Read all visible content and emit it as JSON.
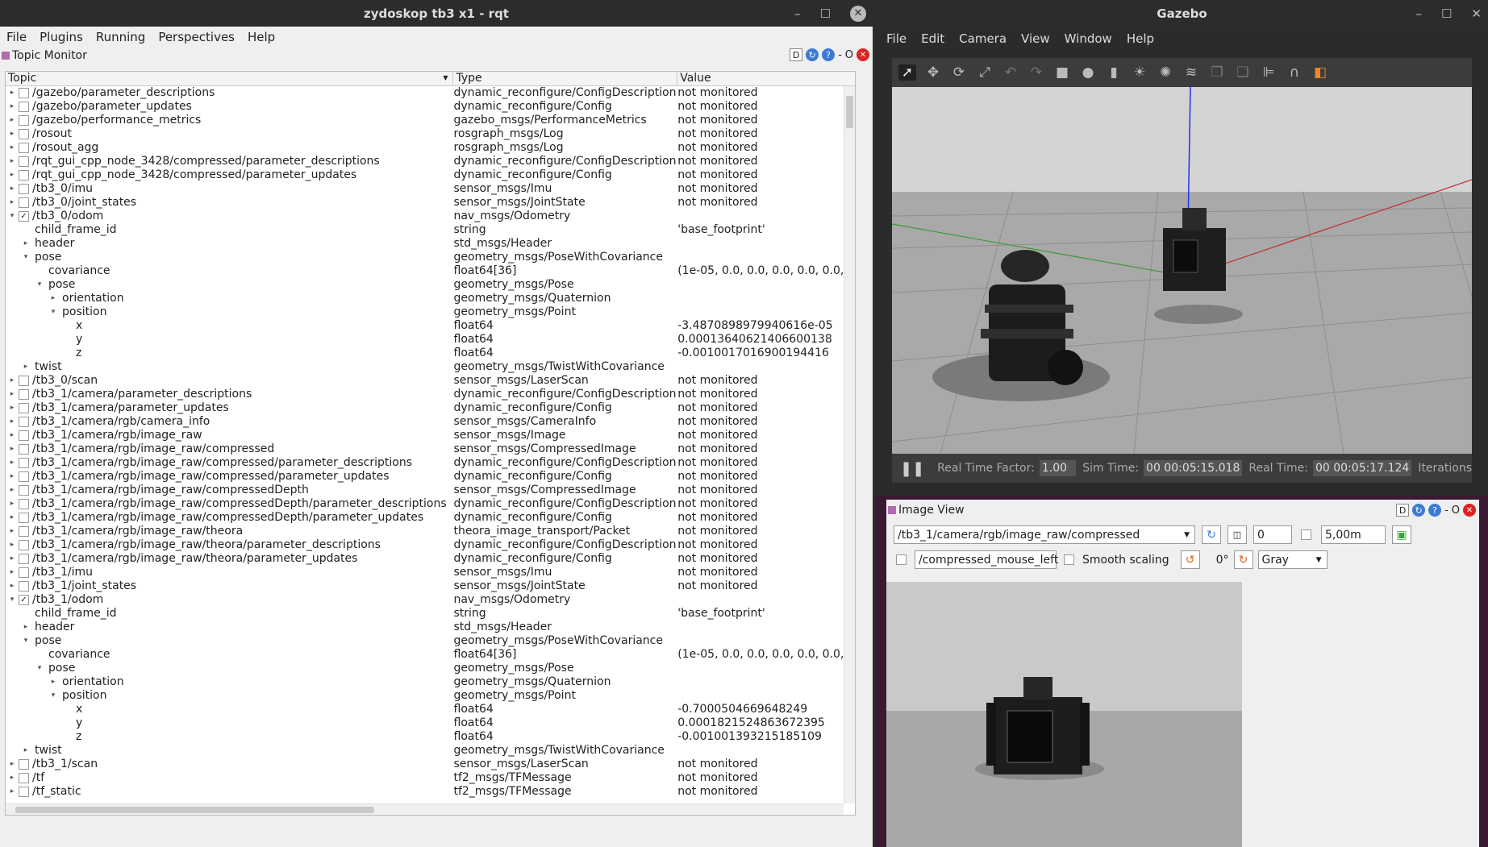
{
  "rqt": {
    "title": "zydoskop tb3 x1 - rqt",
    "menu": [
      "File",
      "Plugins",
      "Running",
      "Perspectives",
      "Help"
    ],
    "plugin": "Topic Monitor",
    "columns": [
      "Topic",
      "Type",
      "Value"
    ],
    "rows": [
      {
        "t": "/gazebo/parameter_descriptions",
        "ty": "dynamic_reconfigure/ConfigDescription",
        "v": "not monitored",
        "l": 0,
        "a": "r",
        "c": 0
      },
      {
        "t": "/gazebo/parameter_updates",
        "ty": "dynamic_reconfigure/Config",
        "v": "not monitored",
        "l": 0,
        "a": "r",
        "c": 0
      },
      {
        "t": "/gazebo/performance_metrics",
        "ty": "gazebo_msgs/PerformanceMetrics",
        "v": "not monitored",
        "l": 0,
        "a": "r",
        "c": 0
      },
      {
        "t": "/rosout",
        "ty": "rosgraph_msgs/Log",
        "v": "not monitored",
        "l": 0,
        "a": "r",
        "c": 0
      },
      {
        "t": "/rosout_agg",
        "ty": "rosgraph_msgs/Log",
        "v": "not monitored",
        "l": 0,
        "a": "r",
        "c": 0
      },
      {
        "t": "/rqt_gui_cpp_node_3428/compressed/parameter_descriptions",
        "ty": "dynamic_reconfigure/ConfigDescription",
        "v": "not monitored",
        "l": 0,
        "a": "r",
        "c": 0
      },
      {
        "t": "/rqt_gui_cpp_node_3428/compressed/parameter_updates",
        "ty": "dynamic_reconfigure/Config",
        "v": "not monitored",
        "l": 0,
        "a": "r",
        "c": 0
      },
      {
        "t": "/tb3_0/imu",
        "ty": "sensor_msgs/Imu",
        "v": "not monitored",
        "l": 0,
        "a": "r",
        "c": 0
      },
      {
        "t": "/tb3_0/joint_states",
        "ty": "sensor_msgs/JointState",
        "v": "not monitored",
        "l": 0,
        "a": "r",
        "c": 0
      },
      {
        "t": "/tb3_0/odom",
        "ty": "nav_msgs/Odometry",
        "v": "",
        "l": 0,
        "a": "d",
        "c": 1
      },
      {
        "t": "child_frame_id",
        "ty": "string",
        "v": "'base_footprint'",
        "l": 1,
        "a": "",
        "c": -1
      },
      {
        "t": "header",
        "ty": "std_msgs/Header",
        "v": "",
        "l": 1,
        "a": "r",
        "c": -1
      },
      {
        "t": "pose",
        "ty": "geometry_msgs/PoseWithCovariance",
        "v": "",
        "l": 1,
        "a": "d",
        "c": -1
      },
      {
        "t": "covariance",
        "ty": "float64[36]",
        "v": "(1e-05, 0.0, 0.0, 0.0, 0.0, 0.0,",
        "l": 2,
        "a": "",
        "c": -1
      },
      {
        "t": "pose",
        "ty": "geometry_msgs/Pose",
        "v": "",
        "l": 2,
        "a": "d",
        "c": -1
      },
      {
        "t": "orientation",
        "ty": "geometry_msgs/Quaternion",
        "v": "",
        "l": 3,
        "a": "r",
        "c": -1
      },
      {
        "t": "position",
        "ty": "geometry_msgs/Point",
        "v": "",
        "l": 3,
        "a": "d",
        "c": -1
      },
      {
        "t": "x",
        "ty": "float64",
        "v": "-3.4870898979940616e-05",
        "l": 4,
        "a": "",
        "c": -1
      },
      {
        "t": "y",
        "ty": "float64",
        "v": "0.00013640621406600138",
        "l": 4,
        "a": "",
        "c": -1
      },
      {
        "t": "z",
        "ty": "float64",
        "v": "-0.0010017016900194416",
        "l": 4,
        "a": "",
        "c": -1
      },
      {
        "t": "twist",
        "ty": "geometry_msgs/TwistWithCovariance",
        "v": "",
        "l": 1,
        "a": "r",
        "c": -1
      },
      {
        "t": "/tb3_0/scan",
        "ty": "sensor_msgs/LaserScan",
        "v": "not monitored",
        "l": 0,
        "a": "r",
        "c": 0
      },
      {
        "t": "/tb3_1/camera/parameter_descriptions",
        "ty": "dynamic_reconfigure/ConfigDescription",
        "v": "not monitored",
        "l": 0,
        "a": "r",
        "c": 0
      },
      {
        "t": "/tb3_1/camera/parameter_updates",
        "ty": "dynamic_reconfigure/Config",
        "v": "not monitored",
        "l": 0,
        "a": "r",
        "c": 0
      },
      {
        "t": "/tb3_1/camera/rgb/camera_info",
        "ty": "sensor_msgs/CameraInfo",
        "v": "not monitored",
        "l": 0,
        "a": "r",
        "c": 0
      },
      {
        "t": "/tb3_1/camera/rgb/image_raw",
        "ty": "sensor_msgs/Image",
        "v": "not monitored",
        "l": 0,
        "a": "r",
        "c": 0
      },
      {
        "t": "/tb3_1/camera/rgb/image_raw/compressed",
        "ty": "sensor_msgs/CompressedImage",
        "v": "not monitored",
        "l": 0,
        "a": "r",
        "c": 0
      },
      {
        "t": "/tb3_1/camera/rgb/image_raw/compressed/parameter_descriptions",
        "ty": "dynamic_reconfigure/ConfigDescription",
        "v": "not monitored",
        "l": 0,
        "a": "r",
        "c": 0
      },
      {
        "t": "/tb3_1/camera/rgb/image_raw/compressed/parameter_updates",
        "ty": "dynamic_reconfigure/Config",
        "v": "not monitored",
        "l": 0,
        "a": "r",
        "c": 0
      },
      {
        "t": "/tb3_1/camera/rgb/image_raw/compressedDepth",
        "ty": "sensor_msgs/CompressedImage",
        "v": "not monitored",
        "l": 0,
        "a": "r",
        "c": 0
      },
      {
        "t": "/tb3_1/camera/rgb/image_raw/compressedDepth/parameter_descriptions",
        "ty": "dynamic_reconfigure/ConfigDescription",
        "v": "not monitored",
        "l": 0,
        "a": "r",
        "c": 0
      },
      {
        "t": "/tb3_1/camera/rgb/image_raw/compressedDepth/parameter_updates",
        "ty": "dynamic_reconfigure/Config",
        "v": "not monitored",
        "l": 0,
        "a": "r",
        "c": 0
      },
      {
        "t": "/tb3_1/camera/rgb/image_raw/theora",
        "ty": "theora_image_transport/Packet",
        "v": "not monitored",
        "l": 0,
        "a": "r",
        "c": 0
      },
      {
        "t": "/tb3_1/camera/rgb/image_raw/theora/parameter_descriptions",
        "ty": "dynamic_reconfigure/ConfigDescription",
        "v": "not monitored",
        "l": 0,
        "a": "r",
        "c": 0
      },
      {
        "t": "/tb3_1/camera/rgb/image_raw/theora/parameter_updates",
        "ty": "dynamic_reconfigure/Config",
        "v": "not monitored",
        "l": 0,
        "a": "r",
        "c": 0
      },
      {
        "t": "/tb3_1/imu",
        "ty": "sensor_msgs/Imu",
        "v": "not monitored",
        "l": 0,
        "a": "r",
        "c": 0
      },
      {
        "t": "/tb3_1/joint_states",
        "ty": "sensor_msgs/JointState",
        "v": "not monitored",
        "l": 0,
        "a": "r",
        "c": 0
      },
      {
        "t": "/tb3_1/odom",
        "ty": "nav_msgs/Odometry",
        "v": "",
        "l": 0,
        "a": "d",
        "c": 1
      },
      {
        "t": "child_frame_id",
        "ty": "string",
        "v": "'base_footprint'",
        "l": 1,
        "a": "",
        "c": -1
      },
      {
        "t": "header",
        "ty": "std_msgs/Header",
        "v": "",
        "l": 1,
        "a": "r",
        "c": -1
      },
      {
        "t": "pose",
        "ty": "geometry_msgs/PoseWithCovariance",
        "v": "",
        "l": 1,
        "a": "d",
        "c": -1
      },
      {
        "t": "covariance",
        "ty": "float64[36]",
        "v": "(1e-05, 0.0, 0.0, 0.0, 0.0, 0.0,",
        "l": 2,
        "a": "",
        "c": -1
      },
      {
        "t": "pose",
        "ty": "geometry_msgs/Pose",
        "v": "",
        "l": 2,
        "a": "d",
        "c": -1
      },
      {
        "t": "orientation",
        "ty": "geometry_msgs/Quaternion",
        "v": "",
        "l": 3,
        "a": "r",
        "c": -1
      },
      {
        "t": "position",
        "ty": "geometry_msgs/Point",
        "v": "",
        "l": 3,
        "a": "d",
        "c": -1
      },
      {
        "t": "x",
        "ty": "float64",
        "v": "-0.7000504669648249",
        "l": 4,
        "a": "",
        "c": -1
      },
      {
        "t": "y",
        "ty": "float64",
        "v": "0.0001821524863672395",
        "l": 4,
        "a": "",
        "c": -1
      },
      {
        "t": "z",
        "ty": "float64",
        "v": "-0.001001393215185109",
        "l": 4,
        "a": "",
        "c": -1
      },
      {
        "t": "twist",
        "ty": "geometry_msgs/TwistWithCovariance",
        "v": "",
        "l": 1,
        "a": "r",
        "c": -1
      },
      {
        "t": "/tb3_1/scan",
        "ty": "sensor_msgs/LaserScan",
        "v": "not monitored",
        "l": 0,
        "a": "r",
        "c": 0
      },
      {
        "t": "/tf",
        "ty": "tf2_msgs/TFMessage",
        "v": "not monitored",
        "l": 0,
        "a": "r",
        "c": 0
      },
      {
        "t": "/tf_static",
        "ty": "tf2_msgs/TFMessage",
        "v": "not monitored",
        "l": 0,
        "a": "r",
        "c": 0
      }
    ]
  },
  "gazebo": {
    "title": "Gazebo",
    "menu": [
      "File",
      "Edit",
      "Camera",
      "View",
      "Window",
      "Help"
    ],
    "rtf_label": "Real Time Factor:",
    "rtf": "1.00",
    "sim_label": "Sim Time:",
    "sim": "00 00:05:15.018",
    "real_label": "Real Time:",
    "real": "00 00:05:17.124",
    "iter_label": "Iterations"
  },
  "imageview": {
    "title": "Image View",
    "topic": "/tb3_1/camera/rgb/image_raw/compressed",
    "num1": "0",
    "num2": "5,00m",
    "mouse_topic": "/compressed_mouse_left",
    "smooth": "Smooth scaling",
    "rotation": "0°",
    "colormap": "Gray"
  }
}
